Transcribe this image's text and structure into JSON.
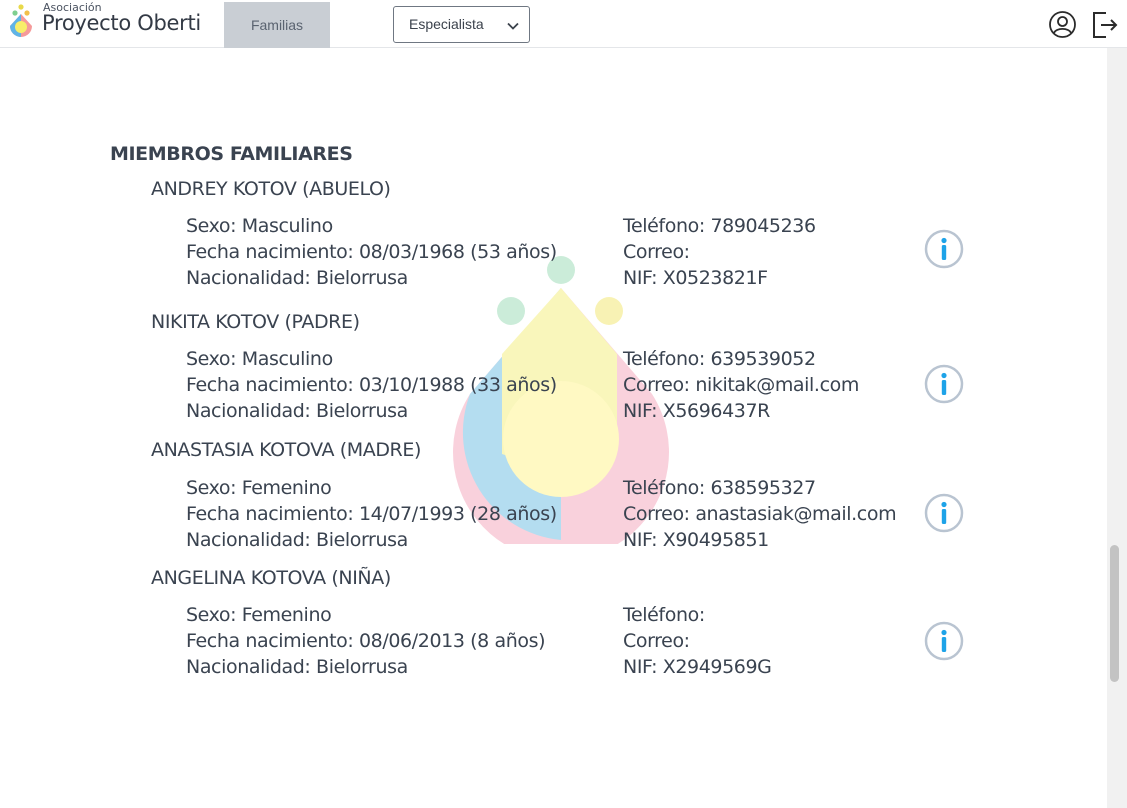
{
  "header": {
    "logo_small": "Asociación",
    "logo_main": "Proyecto Oberti",
    "tab_label": "Familias",
    "role_select_value": "Especialista",
    "profile_icon": "user-circle-icon",
    "logout_icon": "logout-icon"
  },
  "colors": {
    "tab_bg": "#c9ced4",
    "info_blue": "#1ea3e8",
    "info_ring": "#b9c4d1",
    "text": "#3a4350"
  },
  "section": {
    "title": "MIEMBROS FAMILIARES"
  },
  "members": [
    {
      "name": "ANDREY KOTOV (ABUELO)",
      "sexo": "Sexo: Masculino",
      "nacimiento": "Fecha nacimiento: 08/03/1968  (53 años)",
      "nacionalidad": "Nacionalidad: Bielorrusa",
      "telefono": "Teléfono: 789045236",
      "correo": "Correo:",
      "nif": "NIF: X0523821F"
    },
    {
      "name": "NIKITA KOTOV (PADRE)",
      "sexo": "Sexo: Masculino",
      "nacimiento": "Fecha nacimiento: 03/10/1988  (33 años)",
      "nacionalidad": "Nacionalidad: Bielorrusa",
      "telefono": "Teléfono: 639539052",
      "correo": "Correo:  nikitak@mail.com",
      "nif": "NIF: X5696437R"
    },
    {
      "name": "ANASTASIA KOTOVA (MADRE)",
      "sexo": "Sexo: Femenino",
      "nacimiento": "Fecha nacimiento: 14/07/1993  (28 años)",
      "nacionalidad": "Nacionalidad: Bielorrusa",
      "telefono": "Teléfono: 638595327",
      "correo": "Correo: anastasiak@mail.com",
      "nif": "NIF: X90495851"
    },
    {
      "name": "ANGELINA KOTOVA (NIÑA)",
      "sexo": "Sexo: Femenino",
      "nacimiento": "Fecha nacimiento: 08/06/2013 (8 años)",
      "nacionalidad": "Nacionalidad: Bielorrusa",
      "telefono": "Teléfono:",
      "correo": "Correo:",
      "nif": "NIF: X2949569G"
    }
  ]
}
